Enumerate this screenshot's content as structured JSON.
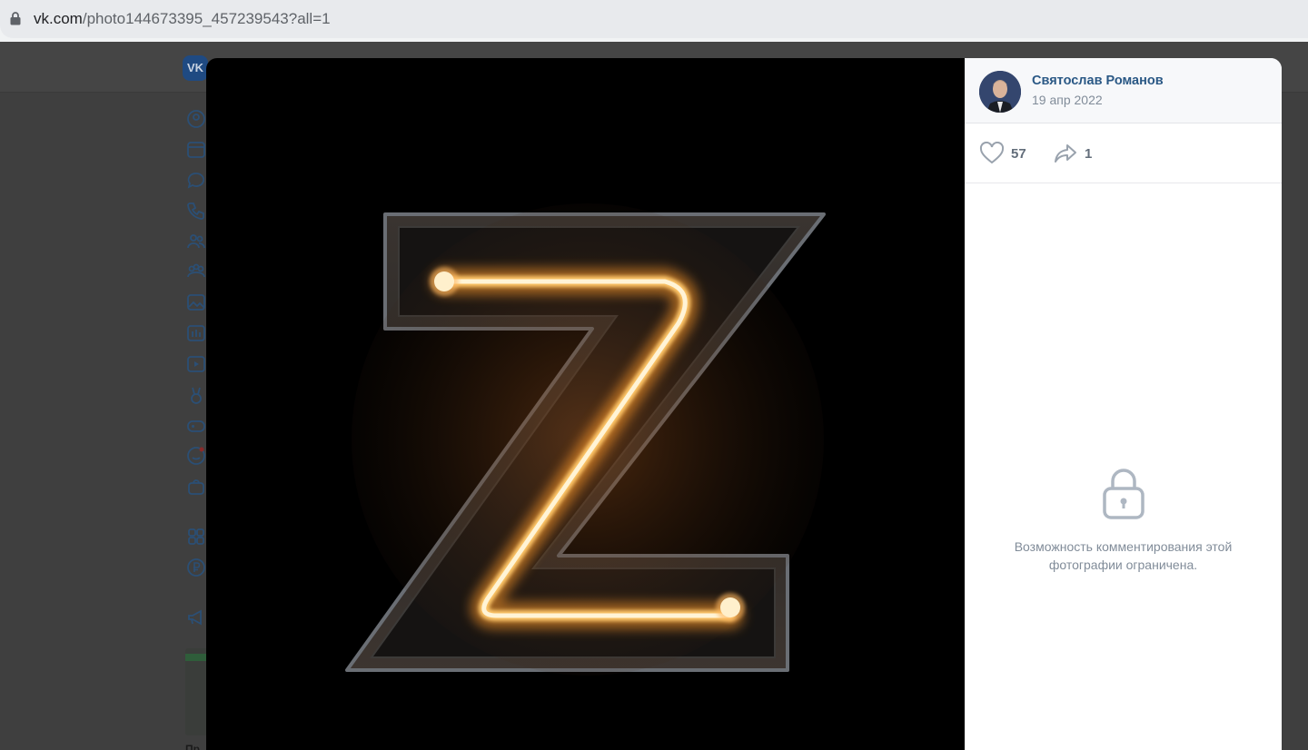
{
  "browser": {
    "url_host": "vk.com",
    "url_path": "/photo144673395_457239543?all=1"
  },
  "page": {
    "logo_text": "VK",
    "sidebar_icons": [
      "profile-icon",
      "news-icon",
      "messenger-icon",
      "calls-icon",
      "friends-icon",
      "communities-icon",
      "photos-icon",
      "music-icon",
      "video-icon",
      "clips-icon",
      "games-icon",
      "stickers-icon",
      "market-icon",
      "services-icon",
      "vk-pay-icon",
      "ads-icon"
    ],
    "ad_caption": "Пр"
  },
  "viewer": {
    "photo_subject": "neon-letter-z",
    "author": {
      "name": "Святослав Романов",
      "date": "19 апр 2022"
    },
    "likes": "57",
    "shares": "1",
    "comments_notice": "Возможность комментирования этой фотографии ограничена.",
    "colors": {
      "link": "#2a5885",
      "muted": "#818c99",
      "neon": "#ffd89a"
    }
  }
}
